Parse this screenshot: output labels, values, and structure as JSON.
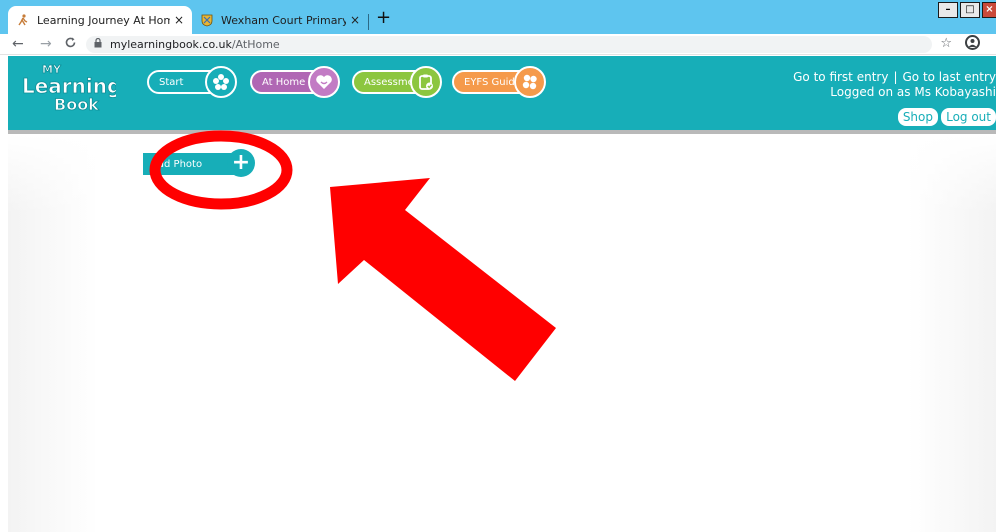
{
  "browser": {
    "tabs": [
      {
        "title": "Learning Journey At Home",
        "favicon": "runner-icon",
        "active": true
      },
      {
        "title": "Wexham Court Primary - Home",
        "favicon": "school-crest-icon",
        "active": false
      }
    ],
    "close_glyph": "×",
    "new_tab_glyph": "+",
    "window_controls": {
      "minimize": "–",
      "maximize": "□",
      "close": "×"
    },
    "address": {
      "host": "mylearningbook.co.uk",
      "path": "/AtHome"
    }
  },
  "site": {
    "logo": {
      "line1": "MY",
      "line2": "Learning",
      "line3": "Book"
    },
    "nav": [
      {
        "label": "Start",
        "icon": "flower-icon",
        "color": "#17aeb8"
      },
      {
        "label": "At Home",
        "icon": "heart-icon",
        "color": "#b067b4"
      },
      {
        "label": "Assessments",
        "icon": "clipboard-check-icon",
        "color": "#8cc63f"
      },
      {
        "label": "EYFS Guide",
        "icon": "cluster-icon",
        "color": "#f59a4b"
      }
    ],
    "links": {
      "first": "Go to first entry",
      "separator": "|",
      "last": "Go to last entry"
    },
    "user": "Logged on as Ms Kobayashi",
    "shop": "Shop",
    "logout": "Log out",
    "accent": "#17aeb8"
  },
  "content": {
    "add_photo": "Add Photo",
    "add_photo_glyph": "+"
  },
  "annotation": {
    "color": "#ff0000",
    "shapes": [
      "ellipse",
      "arrow"
    ]
  }
}
